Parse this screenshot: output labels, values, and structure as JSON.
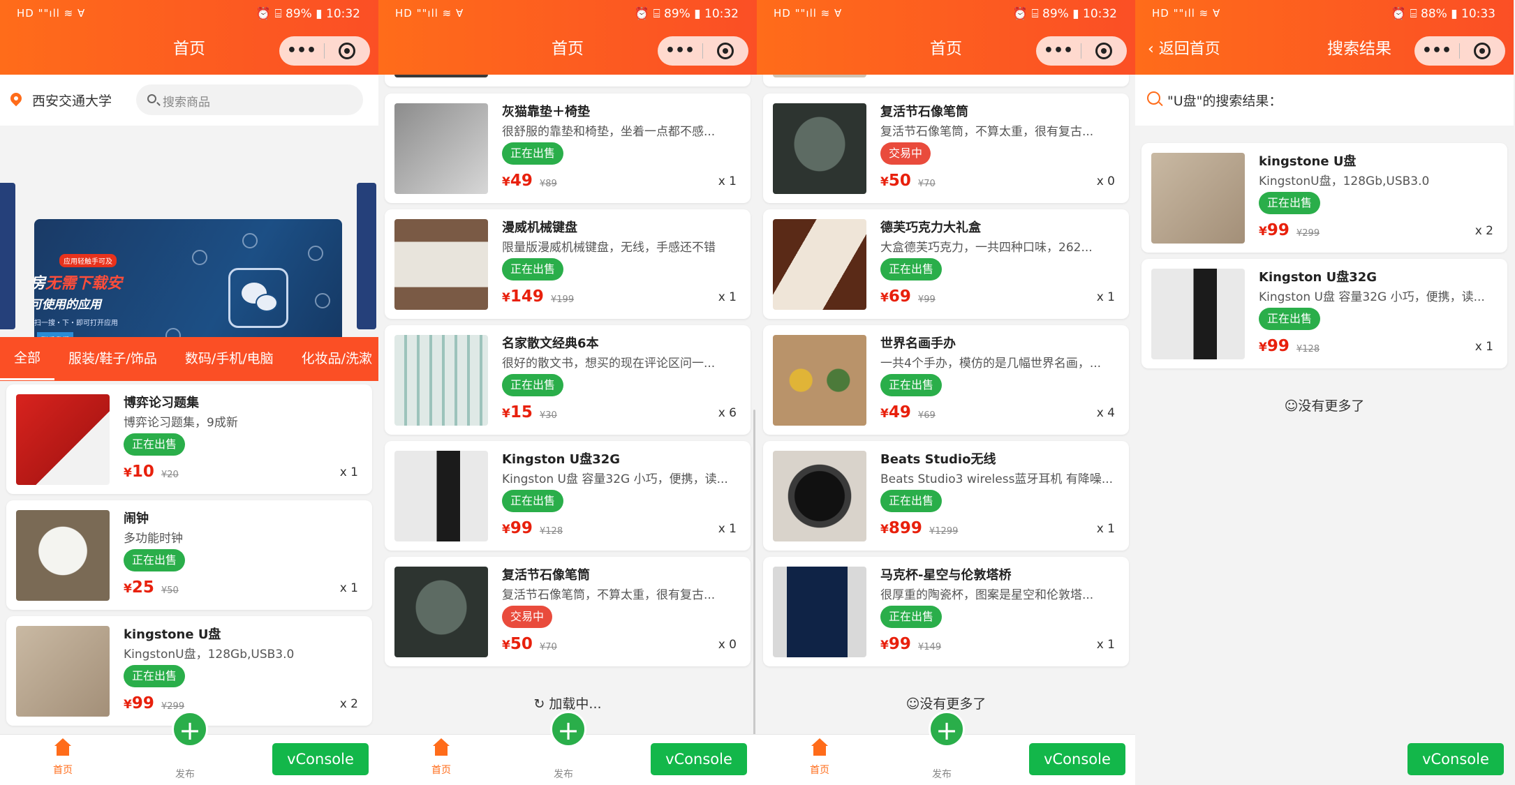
{
  "status": {
    "left": "HD \"\"ıll ≋ ∀",
    "right1": "⏰ ⌸ 89% ▮ 10:32",
    "right2": "⏰ ⌸ 88% ▮ 10:33"
  },
  "colors": {
    "accent": "#ff6c1a",
    "cat_bar": "#fb4f25",
    "status_selling": "#2aae4a",
    "status_trading": "#e94b3c",
    "price": "#e8200c",
    "vconsole": "#13b74a"
  },
  "home": {
    "title": "首页"
  },
  "results_page": {
    "title": "搜索结果",
    "back": "返回首页",
    "heading": "\"U盘\"的搜索结果："
  },
  "search": {
    "location": "西安交通大学",
    "placeholder": "搜索商品"
  },
  "banner": {
    "badge": "应用轻触手可及",
    "line1a": "房",
    "line1b": "无需下载安",
    "line2": "可使用的应用",
    "line3": "扫一搜・下・即可打开应用",
    "button": "联系我们"
  },
  "categories": [
    "全部",
    "服装/鞋子/饰品",
    "数码/手机/电脑",
    "化妆品/洗漱"
  ],
  "currency": "¥",
  "panel1": [
    {
      "title": "博弈论习题集",
      "desc": "博弈论习题集，9成新",
      "status": "正在出售",
      "price": "10",
      "oprice": "¥20",
      "qty": "x 1"
    },
    {
      "title": "闹钟",
      "desc": "多功能时钟",
      "status": "正在出售",
      "price": "25",
      "oprice": "¥50",
      "qty": "x 1"
    },
    {
      "title": "kingstone U盘",
      "desc": "KingstonU盘，128Gb,USB3.0",
      "status": "正在出售",
      "price": "99",
      "oprice": "¥299",
      "qty": "x 2"
    }
  ],
  "panel2": [
    {
      "title": "灰猫靠垫＋椅垫",
      "desc": "很舒服的靠垫和椅垫，坐着一点都不感...",
      "status": "正在出售",
      "price": "49",
      "oprice": "¥89",
      "qty": "x 1"
    },
    {
      "title": "漫威机械键盘",
      "desc": "限量版漫威机械键盘，无线，手感还不错",
      "status": "正在出售",
      "price": "149",
      "oprice": "¥199",
      "qty": "x 1"
    },
    {
      "title": "名家散文经典6本",
      "desc": "很好的散文书，想买的现在评论区问一...",
      "status": "正在出售",
      "price": "15",
      "oprice": "¥30",
      "qty": "x 6"
    },
    {
      "title": "Kingston U盘32G",
      "desc": "Kingston U盘 容量32G 小巧，便携，读...",
      "status": "正在出售",
      "price": "99",
      "oprice": "¥128",
      "qty": "x 1"
    },
    {
      "title": "复活节石像笔筒",
      "desc": "复活节石像笔筒，不算太重，很有复古...",
      "status": "交易中",
      "price": "50",
      "oprice": "¥70",
      "qty": "x 0"
    }
  ],
  "panel3": [
    {
      "title": "复活节石像笔筒",
      "desc": "复活节石像笔筒，不算太重，很有复古...",
      "status": "交易中",
      "price": "50",
      "oprice": "¥70",
      "qty": "x 0"
    },
    {
      "title": "德芙巧克力大礼盒",
      "desc": "大盒德芙巧克力，一共四种口味，262...",
      "status": "正在出售",
      "price": "69",
      "oprice": "¥99",
      "qty": "x 1"
    },
    {
      "title": "世界名画手办",
      "desc": "一共4个手办，模仿的是几幅世界名画，...",
      "status": "正在出售",
      "price": "49",
      "oprice": "¥69",
      "qty": "x 4"
    },
    {
      "title": "Beats Studio无线",
      "desc": "Beats Studio3 wireless蓝牙耳机 有降噪...",
      "status": "正在出售",
      "price": "899",
      "oprice": "¥1299",
      "qty": "x 1"
    },
    {
      "title": "马克杯-星空与伦敦塔桥",
      "desc": "很厚重的陶瓷杯，图案是星空和伦敦塔...",
      "status": "正在出售",
      "price": "99",
      "oprice": "¥149",
      "qty": "x 1"
    }
  ],
  "panel4": [
    {
      "title": "kingstone U盘",
      "desc": "KingstonU盘，128Gb,USB3.0",
      "status": "正在出售",
      "price": "99",
      "oprice": "¥299",
      "qty": "x 2"
    },
    {
      "title": "Kingston U盘32G",
      "desc": "Kingston U盘 容量32G 小巧，便携，读...",
      "status": "正在出售",
      "price": "99",
      "oprice": "¥128",
      "qty": "x 1"
    }
  ],
  "messages": {
    "loading": "加载中...",
    "no_more": "没有更多了"
  },
  "tabbar": {
    "home": "首页",
    "publish": "发布"
  },
  "vconsole": "vConsole"
}
